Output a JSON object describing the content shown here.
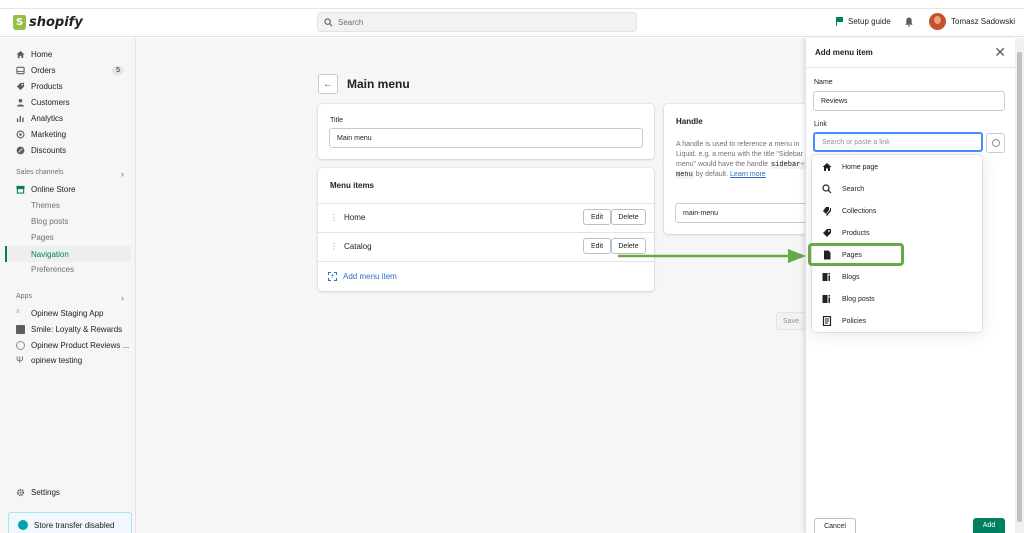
{
  "topbar": {
    "logo": "shopify",
    "search_placeholder": "Search",
    "setup_guide": "Setup guide",
    "user_name": "Tomasz Sadowski"
  },
  "sidebar": {
    "items": [
      {
        "label": "Home",
        "icon": "home-icon"
      },
      {
        "label": "Orders",
        "icon": "orders-icon",
        "badge": "5"
      },
      {
        "label": "Products",
        "icon": "tag-icon"
      },
      {
        "label": "Customers",
        "icon": "person-icon"
      },
      {
        "label": "Analytics",
        "icon": "bar-chart-icon"
      },
      {
        "label": "Marketing",
        "icon": "target-icon"
      },
      {
        "label": "Discounts",
        "icon": "discount-icon"
      }
    ],
    "sales_channels_label": "Sales channels",
    "online_store": "Online Store",
    "online_store_sub": [
      "Themes",
      "Blog posts",
      "Pages",
      "Navigation",
      "Preferences"
    ],
    "apps_label": "Apps",
    "apps": [
      "Opinew Staging App",
      "Smile: Loyalty & Rewards",
      "Opinew Product Reviews ...",
      "opinew testing"
    ],
    "settings": "Settings",
    "transfer_notice": "Store transfer disabled"
  },
  "main": {
    "page_title": "Main menu",
    "title_label": "Title",
    "title_value": "Main menu",
    "menu_items_title": "Menu items",
    "menu_items": [
      {
        "label": "Home",
        "edit": "Edit",
        "delete": "Delete"
      },
      {
        "label": "Catalog",
        "edit": "Edit",
        "delete": "Delete"
      }
    ],
    "add_menu_item": "Add menu item",
    "handle_title": "Handle",
    "handle_desc_1": "A handle is used to reference a menu in Liquid. e.g. a menu with the title \"Sidebar menu\" would have the handle",
    "handle_code": "sidebar-menu",
    "handle_desc_2": "by default.",
    "handle_learn": "Learn more",
    "handle_value": "main-menu",
    "save": "Save"
  },
  "panel": {
    "title": "Add menu item",
    "name_label": "Name",
    "name_value": "Reviews",
    "link_label": "Link",
    "link_placeholder": "Search or paste a link",
    "options": [
      {
        "label": "Home page",
        "icon": "home-icon"
      },
      {
        "label": "Search",
        "icon": "search-icon"
      },
      {
        "label": "Collections",
        "icon": "collections-icon"
      },
      {
        "label": "Products",
        "icon": "tag-icon"
      },
      {
        "label": "Pages",
        "icon": "page-icon"
      },
      {
        "label": "Blogs",
        "icon": "blog-icon"
      },
      {
        "label": "Blog posts",
        "icon": "blog-icon"
      },
      {
        "label": "Policies",
        "icon": "policy-icon"
      }
    ],
    "cancel": "Cancel",
    "add": "Add"
  },
  "colors": {
    "accent": "#008060",
    "highlight": "#67a949",
    "link": "#2c6ecb"
  }
}
